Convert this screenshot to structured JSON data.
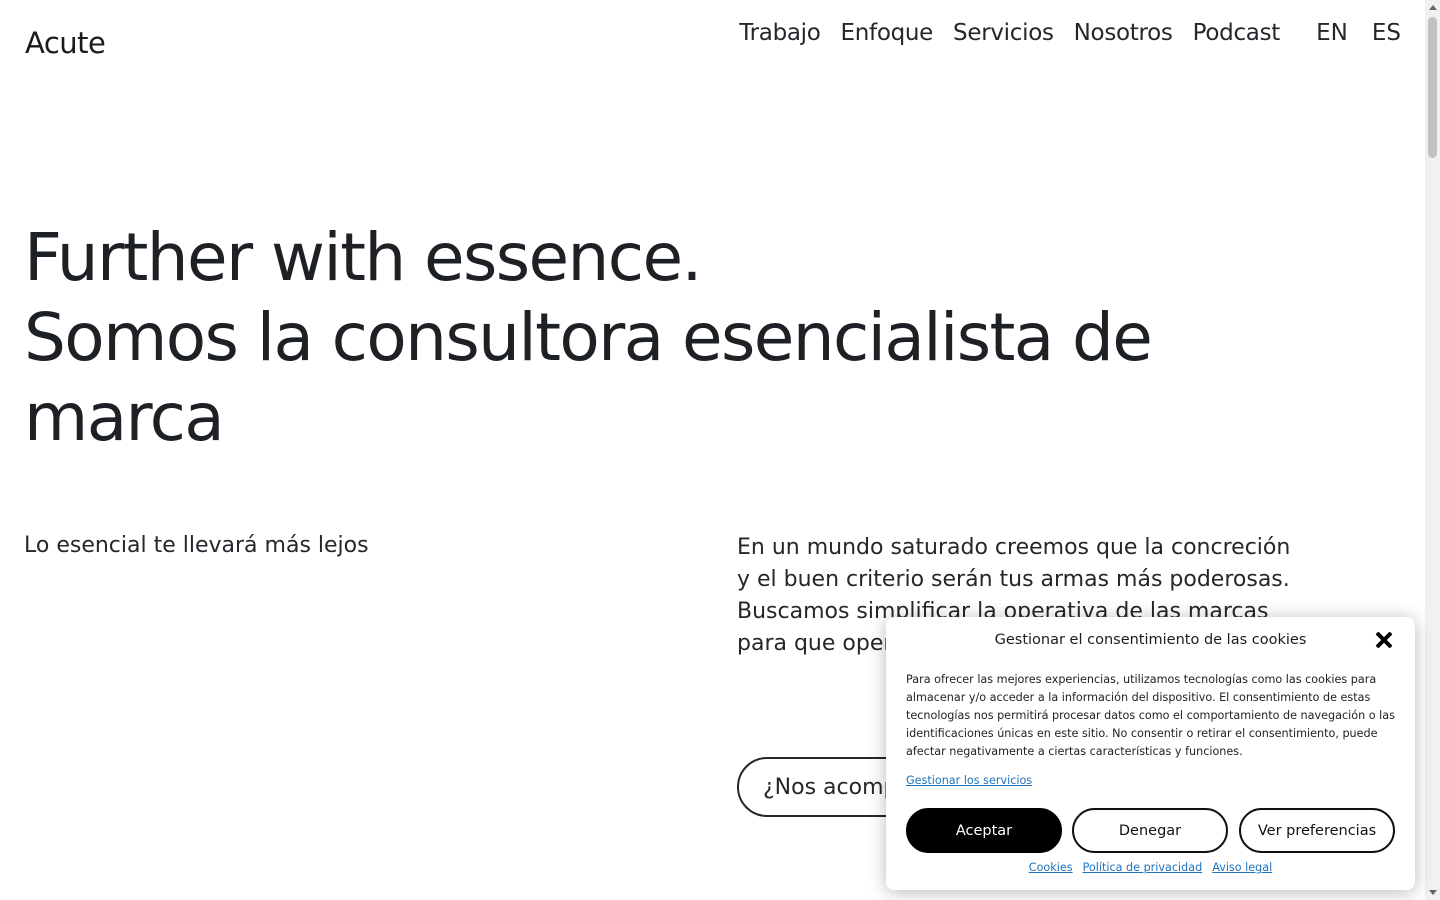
{
  "header": {
    "logo": "Acute",
    "nav": [
      "Trabajo",
      "Enfoque",
      "Servicios",
      "Nosotros",
      "Podcast"
    ],
    "languages": [
      "EN",
      "ES"
    ]
  },
  "hero": {
    "line1": "Further with essence.",
    "line2": "Somos la consultora esencialista de marca"
  },
  "tagline": "Lo esencial te llevará más lejos",
  "intro": "En un mundo saturado creemos que la concreción y el buen criterio serán tus armas más poderosas. Buscamos simplificar la operativa de las marcas para que operen con más foco y claridad.",
  "cta": "¿Nos acompañas?",
  "cookie_banner": {
    "title": "Gestionar el consentimiento de las cookies",
    "text": "Para ofrecer las mejores experiencias, utilizamos tecnologías como las cookies para almacenar y/o acceder a la información del dispositivo. El consentimiento de estas tecnologías nos permitirá procesar datos como el comportamiento de navegación o las identificaciones únicas en este sitio. No consentir o retirar el consentimiento, puede afectar negativamente a ciertas características y funciones.",
    "manage_link": "Gestionar los servicios",
    "accept": "Aceptar",
    "deny": "Denegar",
    "preferences": "Ver preferencias",
    "links": [
      "Cookies",
      "Política de privacidad",
      "Aviso legal"
    ]
  }
}
